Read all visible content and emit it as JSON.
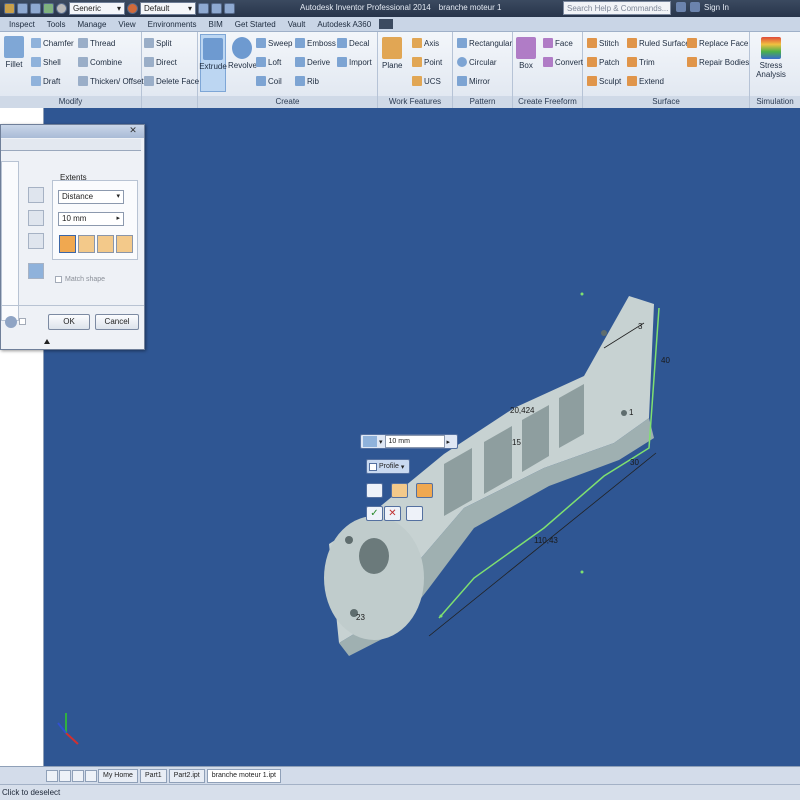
{
  "titlebar": {
    "qat_combo_material": "Generic",
    "qat_combo_appearance": "Default",
    "app_title": "Autodesk Inventor Professional 2014",
    "doc_title": "branche moteur 1",
    "search_placeholder": "Search Help & Commands...",
    "signin": "Sign In"
  },
  "menu": {
    "tabs": [
      "Inspect",
      "Tools",
      "Manage",
      "View",
      "Environments",
      "BIM",
      "Get Started",
      "Vault",
      "Autodesk A360"
    ]
  },
  "ribbon": {
    "modify": {
      "title": "Modify",
      "fillet": "Fillet",
      "chamfer": "Chamfer",
      "shell": "Shell",
      "draft": "Draft",
      "thread": "Thread",
      "combine": "Combine",
      "thicken": "Thicken/ Offset",
      "split": "Split",
      "direct": "Direct",
      "delete_face": "Delete Face"
    },
    "create": {
      "title": "Create",
      "extrude": "Extrude",
      "revolve": "Revolve",
      "sweep": "Sweep",
      "loft": "Loft",
      "coil": "Coil",
      "emboss": "Emboss",
      "derive": "Derive",
      "rib": "Rib",
      "decal": "Decal",
      "import": "Import"
    },
    "work_features": {
      "title": "Work Features",
      "plane": "Plane",
      "axis": "Axis",
      "point": "Point",
      "ucs": "UCS"
    },
    "pattern": {
      "title": "Pattern",
      "rectangular": "Rectangular",
      "circular": "Circular",
      "mirror": "Mirror"
    },
    "freeform": {
      "title": "Create Freeform",
      "box": "Box",
      "face": "Face",
      "convert": "Convert"
    },
    "surface": {
      "title": "Surface",
      "stitch": "Stitch",
      "patch": "Patch",
      "sculpt": "Sculpt",
      "ruled_surface": "Ruled Surface",
      "trim": "Trim",
      "extend": "Extend",
      "replace_face": "Replace Face",
      "repair_bodies": "Repair Bodies"
    },
    "simulation": {
      "title": "Simulation",
      "stress_analysis": "Stress Analysis"
    }
  },
  "dialog": {
    "extents_label": "Extents",
    "extents_value": "Distance",
    "distance_value": "10 mm",
    "match_shape": "Match shape",
    "ok": "OK",
    "cancel": "Cancel"
  },
  "viewport": {
    "mini_distance": "10 mm",
    "mini_profile": "Profile",
    "dimensions": [
      "110,43",
      "20,424",
      "15",
      "30",
      "40",
      "1",
      "3",
      "23"
    ]
  },
  "doc_tabs": [
    "My Home",
    "Part1",
    "Part2.ipt",
    "branche moteur 1.ipt"
  ],
  "status_text": "Click to deselect",
  "colors": {
    "viewport_bg": "#2f5693",
    "part_body": "#c8d3d3",
    "highlight": "#7fe070",
    "accent": "#f0a850"
  }
}
